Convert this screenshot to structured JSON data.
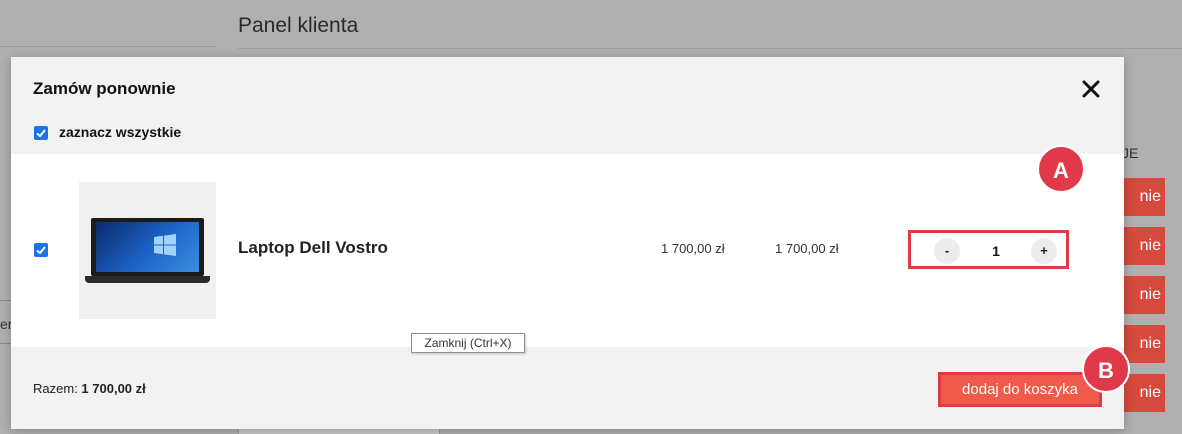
{
  "background": {
    "page_title": "Panel klienta",
    "column_header": "JE",
    "side_text": "er",
    "row_button_label": "nie"
  },
  "modal": {
    "title": "Zamów ponownie",
    "close_label": "✕",
    "select_all_label": "zaznacz wszystkie",
    "select_all_checked": true,
    "item": {
      "checked": true,
      "name": "Laptop Dell Vostro",
      "unit_price": "1 700,00 zł",
      "total_price": "1 700,00 zł",
      "quantity": "1",
      "minus_label": "-",
      "plus_label": "+",
      "image_icon": "laptop-image"
    },
    "tooltip": "Zamknij (Ctrl+X)",
    "total_prefix": "Razem:",
    "total_value": "1 700,00 zł",
    "add_to_cart_label": "dodaj do koszyka"
  },
  "annotations": {
    "badge_a": "A",
    "badge_b": "B",
    "highlight_color": "#e0394a"
  },
  "colors": {
    "accent": "#ef5a4a",
    "checkbox": "#1a73e8",
    "background_button": "#d64a3d"
  }
}
